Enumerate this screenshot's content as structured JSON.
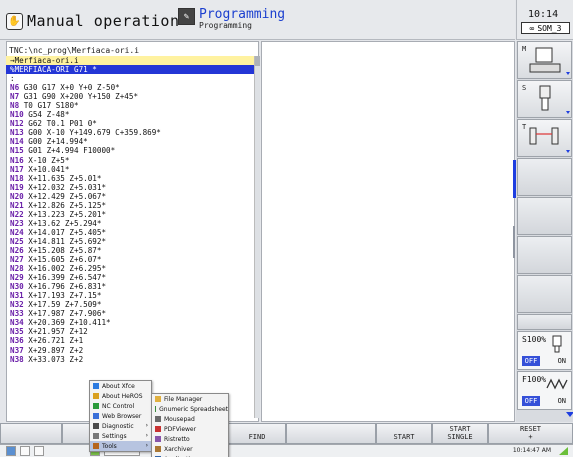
{
  "header": {
    "mode_title": "Manual operation",
    "program_title": "Programming",
    "program_subtitle": "Programming"
  },
  "clock": {
    "time": "10:14",
    "status": "SOM_3"
  },
  "program": {
    "path": "TNC:\\nc_prog\\Merfiaca-ori.i",
    "lines": [
      {
        "num": "",
        "text": "→Merfiaca-ori.i",
        "style": "hl1"
      },
      {
        "num": "",
        "text": "%MERFIACA-ORI G71 *",
        "style": "hl2"
      },
      {
        "num": "",
        "text": ":",
        "style": ""
      },
      {
        "num": "N6",
        "text": " G30 G17 X+0 Y+0 Z-50*",
        "style": ""
      },
      {
        "num": "N7",
        "text": " G31 G90 X+200 Y+150 Z+45*",
        "style": ""
      },
      {
        "num": "N8",
        "text": " T0 G17 S180*",
        "style": ""
      },
      {
        "num": "N10",
        "text": " G54 Z-48*",
        "style": ""
      },
      {
        "num": "N12",
        "text": " G62 T0.1 P01 0*",
        "style": ""
      },
      {
        "num": "N13",
        "text": " G00 X-10 Y+149.679 C+359.869*",
        "style": ""
      },
      {
        "num": "N14",
        "text": " G00 Z+14.994*",
        "style": ""
      },
      {
        "num": "N15",
        "text": " G01 Z+4.994 F10000*",
        "style": ""
      },
      {
        "num": "N16",
        "text": " X-10 Z+5*",
        "style": ""
      },
      {
        "num": "N17",
        "text": " X+10.041*",
        "style": ""
      },
      {
        "num": "N18",
        "text": " X+11.635 Z+5.01*",
        "style": ""
      },
      {
        "num": "N19",
        "text": " X+12.032 Z+5.031*",
        "style": ""
      },
      {
        "num": "N20",
        "text": " X+12.429 Z+5.067*",
        "style": ""
      },
      {
        "num": "N21",
        "text": " X+12.826 Z+5.125*",
        "style": ""
      },
      {
        "num": "N22",
        "text": " X+13.223 Z+5.201*",
        "style": ""
      },
      {
        "num": "N23",
        "text": " X+13.62 Z+5.294*",
        "style": ""
      },
      {
        "num": "N24",
        "text": " X+14.017 Z+5.405*",
        "style": ""
      },
      {
        "num": "N25",
        "text": " X+14.811 Z+5.692*",
        "style": ""
      },
      {
        "num": "N26",
        "text": " X+15.208 Z+5.87*",
        "style": ""
      },
      {
        "num": "N27",
        "text": " X+15.605 Z+6.07*",
        "style": ""
      },
      {
        "num": "N28",
        "text": " X+16.002 Z+6.295*",
        "style": ""
      },
      {
        "num": "N29",
        "text": " X+16.399 Z+6.547*",
        "style": ""
      },
      {
        "num": "N30",
        "text": " X+16.796 Z+6.831*",
        "style": ""
      },
      {
        "num": "N31",
        "text": " X+17.193 Z+7.15*",
        "style": ""
      },
      {
        "num": "N32",
        "text": " X+17.59 Z+7.509*",
        "style": ""
      },
      {
        "num": "N33",
        "text": " X+17.987 Z+7.906*",
        "style": ""
      },
      {
        "num": "N34",
        "text": " X+20.369 Z+10.411*",
        "style": ""
      },
      {
        "num": "N35",
        "text": " X+21.957 Z+12",
        "style": ""
      },
      {
        "num": "N36",
        "text": " X+26.721 Z+1",
        "style": ""
      },
      {
        "num": "N37",
        "text": " X+29.897 Z+2",
        "style": ""
      },
      {
        "num": "N38",
        "text": " X+33.073 Z+2",
        "style": ""
      }
    ]
  },
  "side": {
    "m_label": "M",
    "s_label": "S",
    "t_label": "T",
    "spindle_override": "S100%",
    "feed_override": "F100%",
    "off_label": "OFF",
    "on_label": "ON"
  },
  "softkeys": [
    "",
    "",
    "",
    "FIND",
    "",
    "START",
    "START\nSINGLE",
    "RESET\n+"
  ],
  "taskbar": {
    "time": "10:14:47 AM",
    "edit_label": "Edit"
  },
  "main_menu": [
    {
      "icon": "xfce-icon",
      "label": "About Xfce",
      "arrow": false
    },
    {
      "icon": "heros-icon",
      "label": "About HeROS",
      "arrow": false
    },
    {
      "icon": "nc-icon",
      "label": "NC Control",
      "arrow": false
    },
    {
      "icon": "web-icon",
      "label": "Web Browser",
      "arrow": false
    },
    {
      "icon": "diag-icon",
      "label": "Diagnostic",
      "arrow": true
    },
    {
      "icon": "gear-icon",
      "label": "Settings",
      "arrow": true
    },
    {
      "icon": "tools-icon",
      "label": "Tools",
      "arrow": true
    }
  ],
  "tools_menu": [
    {
      "icon": "folder-icon",
      "label": "File Manager"
    },
    {
      "icon": "sheet-icon",
      "label": "Gnumeric Spreadsheet"
    },
    {
      "icon": "pad-icon",
      "label": "Mousepad"
    },
    {
      "icon": "pdf-icon",
      "label": "PDFViewer"
    },
    {
      "icon": "ristretto-icon",
      "label": "Ristretto"
    },
    {
      "icon": "xarch-icon",
      "label": "Xarchiver"
    },
    {
      "icon": "apps-icon",
      "label": "Applications"
    }
  ]
}
